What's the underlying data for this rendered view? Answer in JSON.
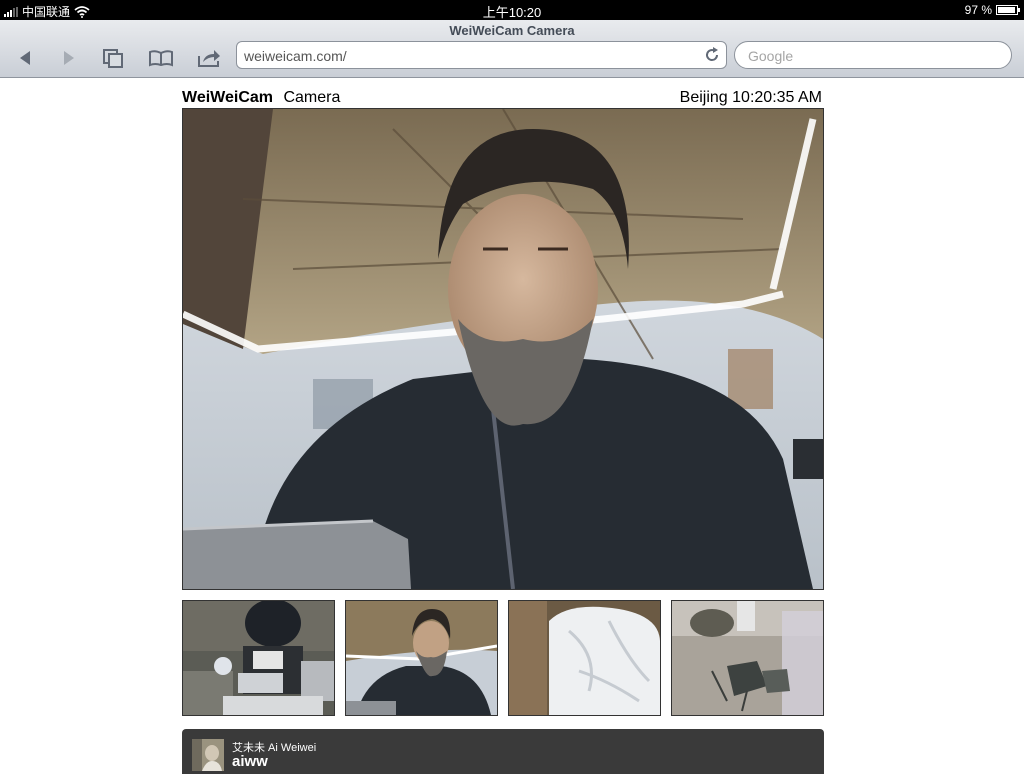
{
  "status_bar": {
    "carrier": "中国联通",
    "time": "上午10:20",
    "battery": "97 %",
    "battery_level": 0.97
  },
  "browser": {
    "page_title": "WeiWeiCam Camera",
    "address": "weiweicam.com/",
    "search_placeholder": "Google",
    "icons": {
      "back": "back-arrow-icon",
      "forward": "forward-arrow-icon",
      "tabs": "pages-icon",
      "bookmarks": "book-icon",
      "share": "share-arrow-icon",
      "reload": "reload-icon"
    }
  },
  "header": {
    "brand": "WeiWeiCam",
    "section": "Camera",
    "clock": "Beijing 10:20:35 AM"
  },
  "cameras": {
    "main": "main-camera-feed",
    "thumbnails": [
      "camera-desk-overhead",
      "camera-portrait",
      "camera-bedroom",
      "camera-courtyard"
    ]
  },
  "profile": {
    "name": "艾未未 Ai Weiwei",
    "handle": "aiww"
  },
  "colors": {
    "status_bar": "#000000",
    "toolbar_top": "#e9ebee",
    "toolbar_bottom": "#c9ced6",
    "profile_bar": "#3a3a3a"
  }
}
